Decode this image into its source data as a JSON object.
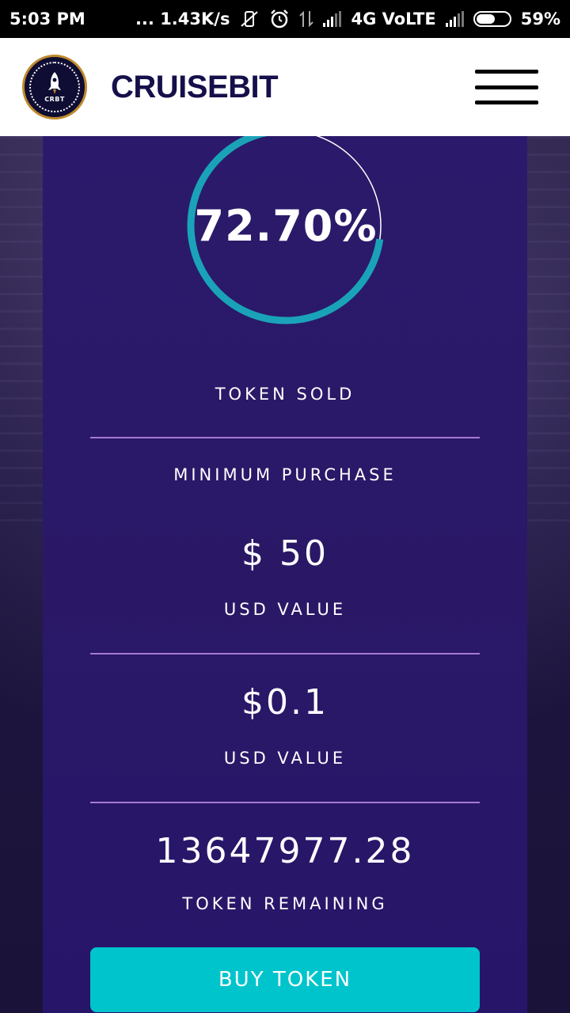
{
  "status_bar": {
    "time": "5:03 PM",
    "network_speed": "... 1.43K/s",
    "network_type": "4G VoLTE",
    "battery": "59%",
    "battery_level": 0.59
  },
  "header": {
    "logo_text": "CRBT",
    "brand": "CRUISEBIT"
  },
  "progress": {
    "value_text": "72.70%",
    "fraction": 0.727,
    "track_color": "#ffffff",
    "fill_color": "#1aa3b8"
  },
  "stats": {
    "token_sold_label": "TOKEN SOLD",
    "min_purchase_label": "MINIMUM PURCHASE",
    "min_purchase_value": "$ 50",
    "min_purchase_unit": "USD VALUE",
    "token_price_value": "$0.1",
    "token_price_unit": "USD VALUE",
    "token_remaining_value": "13647977.28",
    "token_remaining_label": "TOKEN REMAINING"
  },
  "buy_button": {
    "label": "BUY TOKEN",
    "color": "#00c4cc"
  }
}
